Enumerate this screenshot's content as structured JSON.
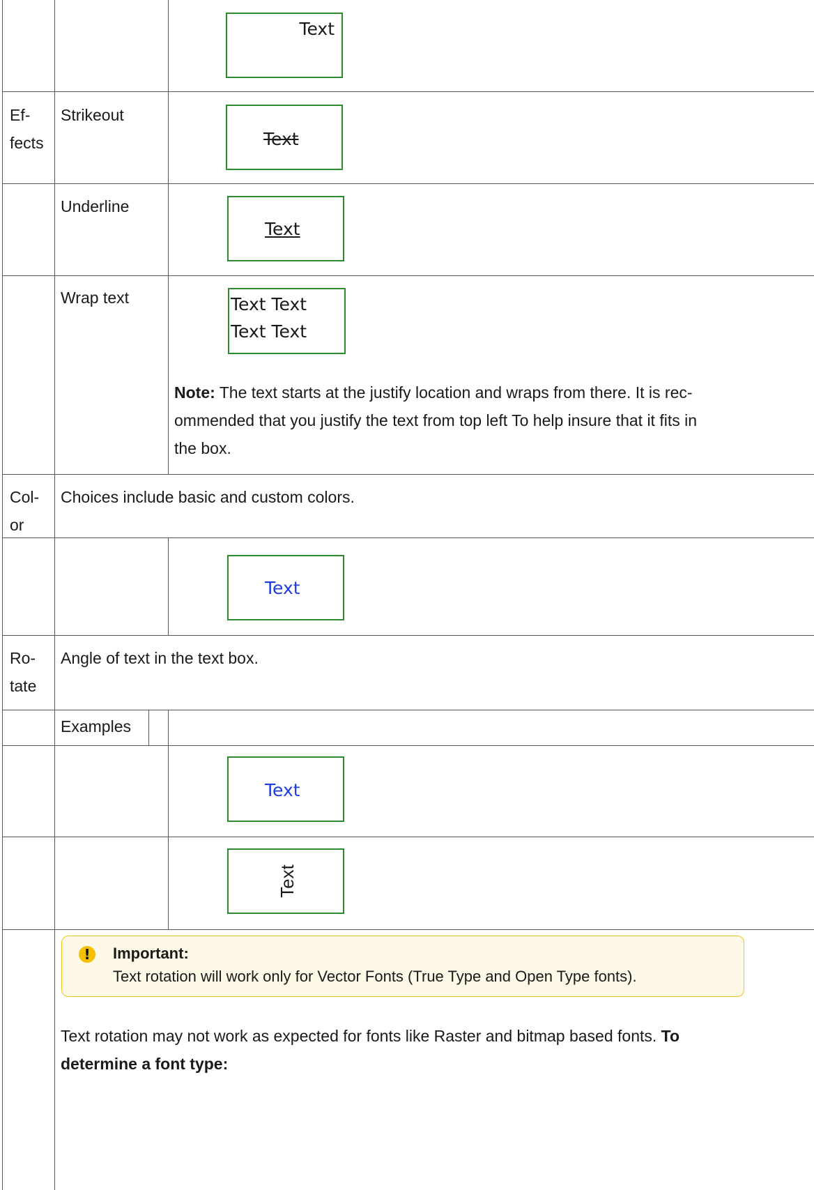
{
  "rows": {
    "alignment_example": {
      "sample": "Text"
    },
    "strikeout": {
      "category": "Ef-\nfects",
      "label": "Strikeout",
      "sample": "Text"
    },
    "underline": {
      "label": "Underline",
      "sample": "Text"
    },
    "wrap_text": {
      "label": "Wrap text",
      "sample_line1": "Text Text",
      "sample_line2": "Text Text",
      "note_label": "Note:",
      "note_text": " The text starts at the justify location and wraps from there. It is rec-\nommended that you justify the text from top left To help insure that it fits in\nthe box."
    },
    "color": {
      "category": "Col-\nor",
      "description": "Choices include basic and custom colors.",
      "sample": "Text",
      "sample_color": "#1f3de0"
    },
    "rotate": {
      "category": "Ro-\ntate",
      "description": "Angle of text in the text box.",
      "examples_label": "Examples",
      "example1_sample": "Text",
      "example2_sample": "Text"
    }
  },
  "important": {
    "icon": "exclamation-icon",
    "title": "Important:",
    "text": "Text rotation will work only for Vector Fonts (True Type and Open Type fonts)."
  },
  "footer_paragraph": {
    "text": "Text rotation may not work as expected for fonts like Raster and bitmap based fonts. ",
    "bold_line1": "To",
    "bold_line2": "determine a font type:"
  }
}
